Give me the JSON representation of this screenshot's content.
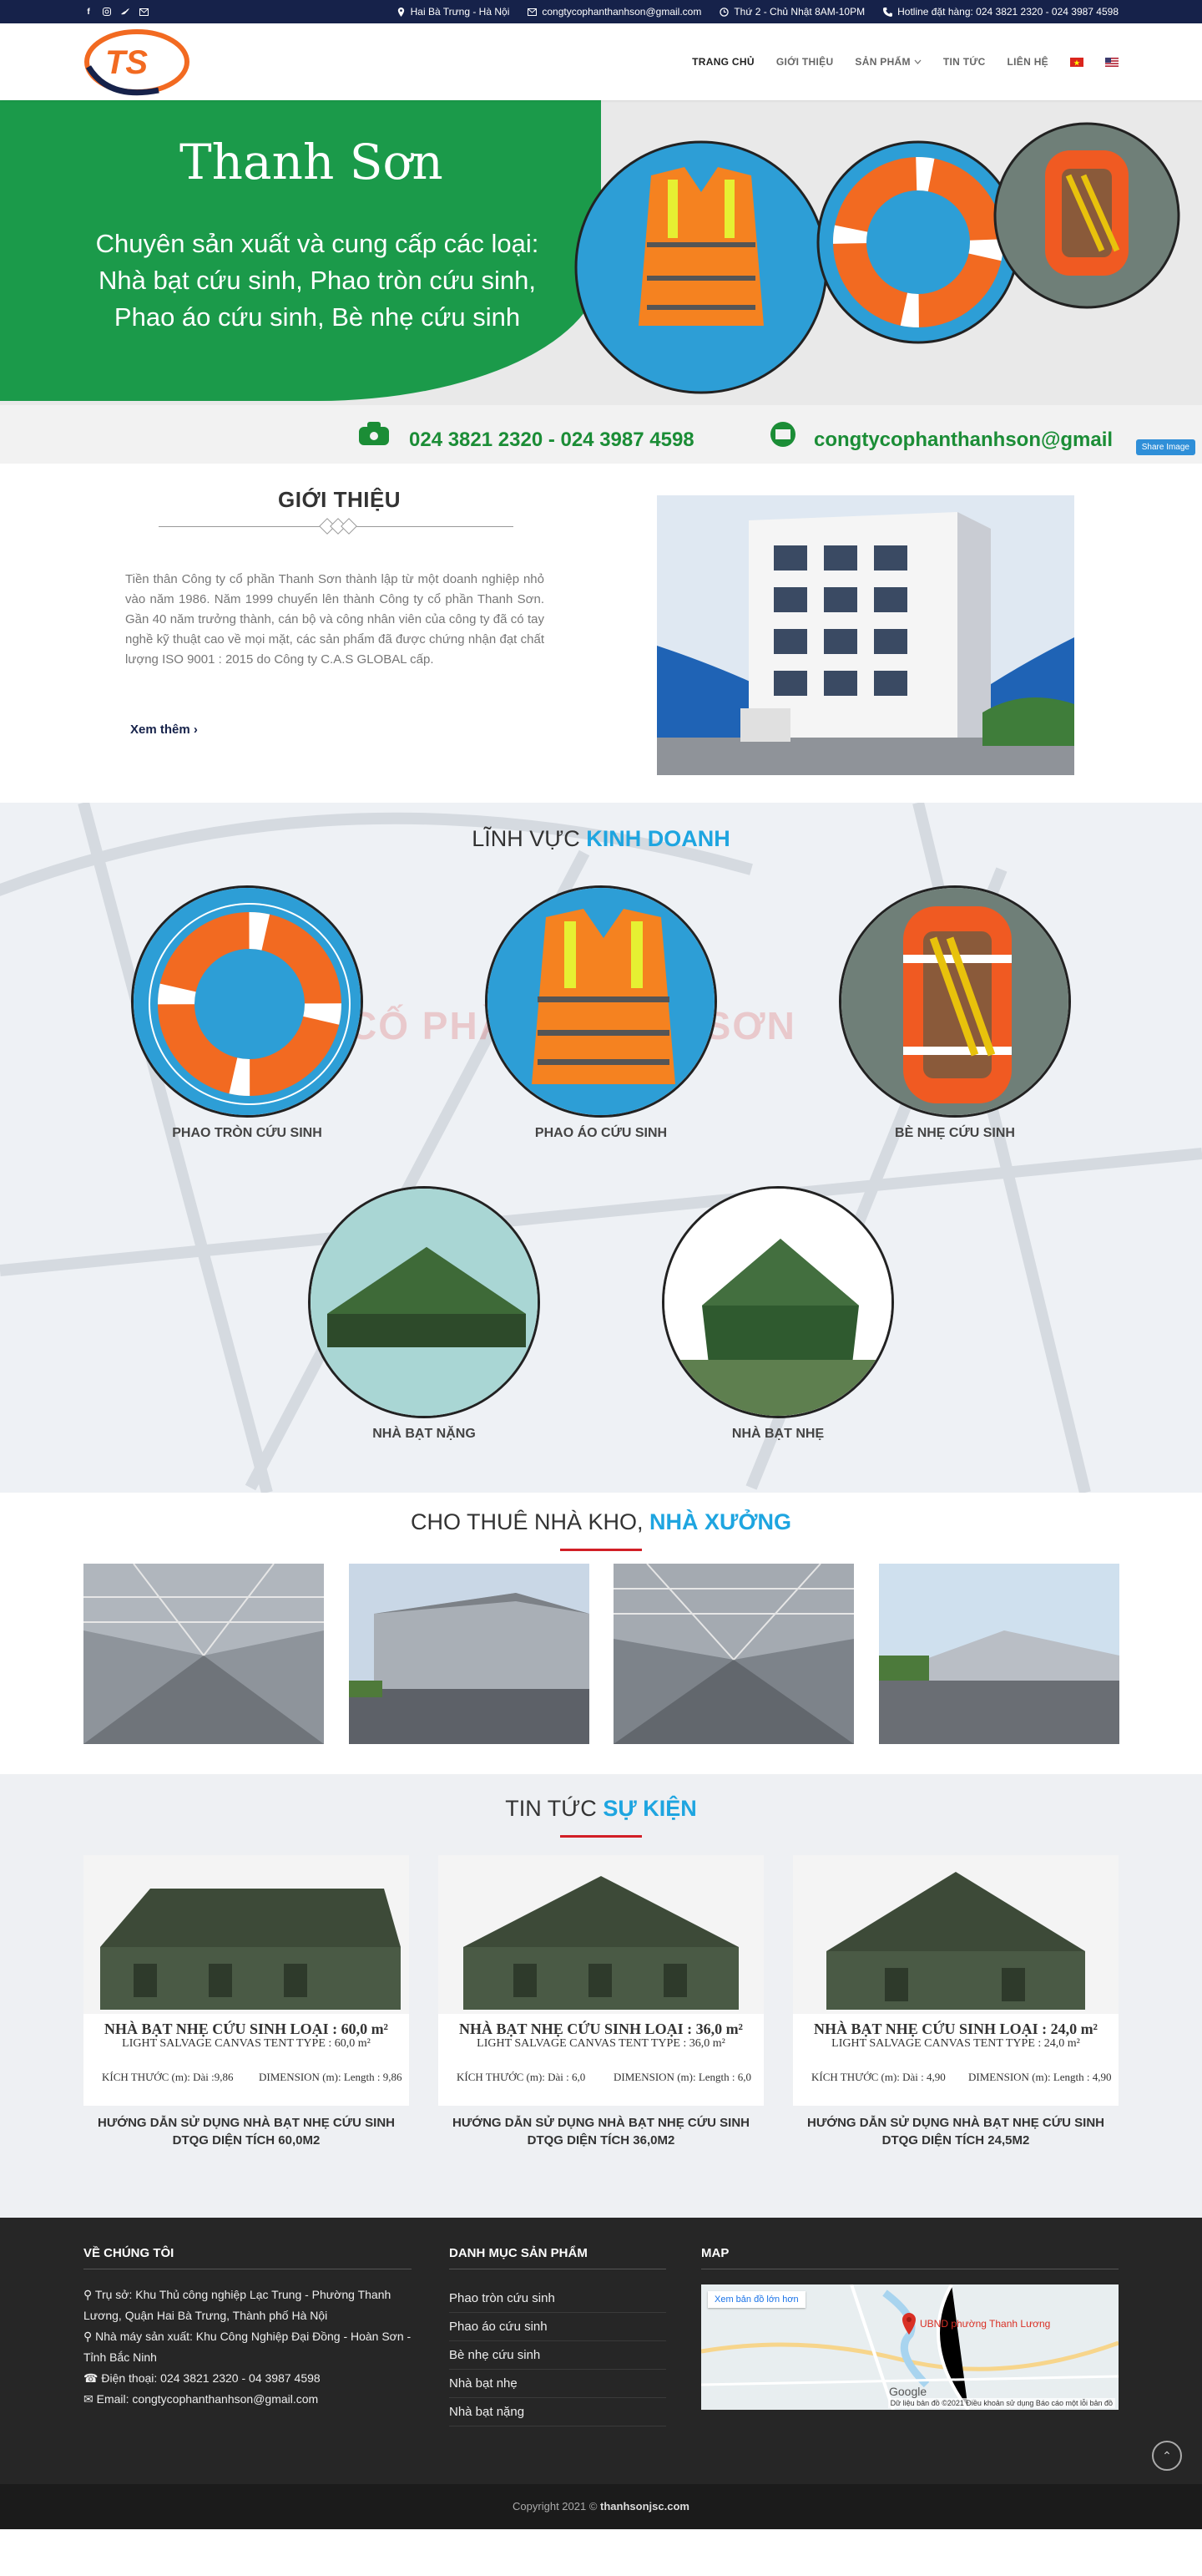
{
  "topbar": {
    "address": "Hai Bà Trưng - Hà Nội",
    "email": "congtycophanthanhson@gmail.com",
    "hours": "Thứ 2 - Chủ Nhật 8AM-10PM",
    "hotline": "Hotline đặt hàng: 024 3821 2320 - 024 3987 4598"
  },
  "nav": {
    "home": "TRANG CHỦ",
    "about": "GIỚI THIỆU",
    "products": "SẢN PHẨM",
    "news": "TIN TỨC",
    "contact": "LIÊN HỆ"
  },
  "banner": {
    "title": "Thanh Sơn",
    "subtitle": "Chuyên sản xuất và cung cấp các loại: Nhà bạt cứu sinh, Phao tròn cứu sinh, Phao áo cứu sinh, Bè nhẹ cứu sinh",
    "phone": "024 3821 2320 - 024 3987 4598",
    "email": "congtycophanthanhson@gmail",
    "share": "Share Image"
  },
  "intro": {
    "heading": "GIỚI THIỆU",
    "text": "Tiền thân Công ty cổ phần Thanh Sơn thành  lập từ một doanh nghiệp nhỏ vào năm 1986. Năm 1999 chuyển lên thành Công ty cổ phần Thanh Sơn. Gần 40 năm trưởng thành, cán bộ và công nhân viên của công ty đã có tay nghề kỹ thuật cao về mọi mặt, các sản phẩm đã được chứng nhận đạt chất lượng ISO 9001 : 2015 do Công ty C.A.S GLOBAL cấp.",
    "more": "Xem thêm"
  },
  "business": {
    "title_a": "LĨNH VỰC",
    "title_b": "KINH DOANH",
    "watermark": "CỐ PHẦN THANH SƠN",
    "items": [
      {
        "label": "PHAO TRÒN CỨU SINH"
      },
      {
        "label": "PHAO ÁO CỨU SINH"
      },
      {
        "label": "BÈ NHẸ CỨU SINH"
      },
      {
        "label": "NHÀ BẠT NẶNG"
      },
      {
        "label": "NHÀ BẠT NHẸ"
      }
    ]
  },
  "warehouse": {
    "title_a": "CHO THUÊ NHÀ KHO,",
    "title_b": "NHÀ XƯỞNG"
  },
  "news": {
    "title_a": "TIN TỨC",
    "title_b": "SỰ KIỆN",
    "items": [
      {
        "cap1": "NHÀ BẠT NHẸ CỨU SINH LOẠI : 60,0 m²",
        "cap2": "LIGHT SALVAGE CANVAS TENT TYPE : 60,0 m²",
        "dims_left": "KÍCH THƯỚC (m): Dài :9,86",
        "dims_right": "DIMENSION (m): Length : 9,86",
        "title": "HƯỚNG DẪN SỬ DỤNG NHÀ BẠT NHẸ CỨU SINH DTQG DIỆN TÍCH 60,0M2"
      },
      {
        "cap1": "NHÀ BẠT NHẸ CỨU SINH LOẠI : 36,0 m²",
        "cap2": "LIGHT SALVAGE CANVAS TENT TYPE : 36,0 m²",
        "dims_left": "KÍCH THƯỚC (m): Dài : 6,0",
        "dims_right": "DIMENSION (m): Length : 6,0",
        "title": "HƯỚNG DẪN SỬ DỤNG NHÀ BẠT NHẸ CỨU SINH DTQG DIỆN TÍCH 36,0M2"
      },
      {
        "cap1": "NHÀ BẠT NHẸ CỨU SINH LOẠI : 24,0 m²",
        "cap2": "LIGHT SALVAGE CANVAS TENT TYPE : 24,0 m²",
        "dims_left": "KÍCH THƯỚC (m): Dài : 4,90",
        "dims_right": "DIMENSION (m): Length : 4,90",
        "title": "HƯỚNG DẪN SỬ DỤNG NHÀ BẠT NHẸ CỨU SINH DTQG DIỆN TÍCH 24,5M2"
      }
    ]
  },
  "footer": {
    "about_title": "VỀ CHÚNG TÔI",
    "head_office": "Trụ sở: Khu Thủ công nghiệp Lạc Trung - Phường Thanh Lương, Quận Hai Bà Trưng, Thành phố Hà Nội",
    "factory": "Nhà máy sản xuất: Khu Công Nghiệp Đại Đồng - Hoàn Sơn - Tỉnh Bắc Ninh",
    "phone": "Điện thoại: 024 3821 2320 - 04 3987 4598",
    "email": "Email: congtycophanthanhson@gmail.com",
    "products_title": "DANH MỤC SẢN PHẨM",
    "products": [
      "Phao tròn cứu sinh",
      "Phao áo cứu sinh",
      "Bè nhẹ cứu sinh",
      "Nhà bạt nhẹ",
      "Nhà bạt nặng"
    ],
    "map_title": "MAP",
    "map_button": "Xem bản đồ lớn hơn",
    "map_pin": "UBND phường Thanh Lương",
    "map_attr": "Dữ liệu bản đồ ©2021  Điều khoản sử dụng  Báo cáo một lỗi bản đồ",
    "copyright_a": "Copyright 2021 ©",
    "copyright_b": "thanhsonjsc.com"
  },
  "colors": {
    "topbar": "#16224a",
    "accent": "#1ea5e0",
    "red": "#d21f26",
    "green": "#1b9a4a",
    "orange": "#f26a21"
  }
}
